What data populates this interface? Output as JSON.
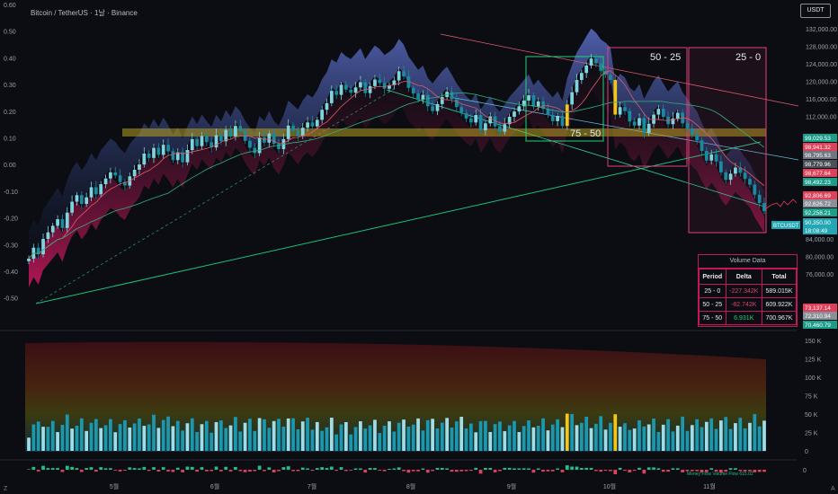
{
  "header": {
    "title": "Bitcoin / TetherUS · 1날 · Binance"
  },
  "currency_button": "USDT",
  "chart_data": {
    "type": "candlestick",
    "x_tick_labels": [
      "5월",
      "6월",
      "7월",
      "8월",
      "9월",
      "10월",
      "11월"
    ],
    "left_axis_labels": [
      "0.60",
      "0.50",
      "0.40",
      "0.30",
      "0.20",
      "0.10",
      "0.00",
      "-0.10",
      "-0.20",
      "-0.30",
      "-0.40",
      "-0.50"
    ],
    "price_axis_labels": [
      "132,000.00",
      "128,000.00",
      "124,000.00",
      "120,000.00",
      "116,000.00",
      "112,000.00",
      "84,000.00",
      "80,000.00",
      "76,000.00"
    ],
    "price_ylim": [
      66000,
      133000
    ],
    "price_badges": [
      {
        "label": "99,029.53",
        "color": "#1a9e8a"
      },
      {
        "label": "98,941.32",
        "color": "#e0405a"
      },
      {
        "label": "98,795.63",
        "color": "#6f7680"
      },
      {
        "label": "98,779.96",
        "color": "#4a4f58"
      },
      {
        "label": "98,677.64",
        "color": "#e0405a"
      },
      {
        "label": "98,492.23",
        "color": "#1a9e8a"
      },
      {
        "label": "92,806.69",
        "color": "#e0405a"
      },
      {
        "label": "92,626.72",
        "color": "#8a8f98"
      },
      {
        "label": "92,258.21",
        "color": "#1a9e8a"
      },
      {
        "label": "90,350.00",
        "color": "#23a7b4"
      },
      {
        "label": "18:08:49",
        "color": "#23a7b4"
      },
      {
        "label": "73,137.14",
        "color": "#e0405a"
      },
      {
        "label": "72,310.94",
        "color": "#8a8f98"
      },
      {
        "label": "70,460.79",
        "color": "#1a9e8a"
      }
    ],
    "symbol_tag": "BTCUSDT",
    "zone_labels": [
      "75 - 50",
      "50 - 25",
      "25 - 0"
    ],
    "volume_axis_labels": [
      "150 K",
      "125 K",
      "100 K",
      "75 K",
      "50 K",
      "25 K",
      "0"
    ],
    "volume_ylim": [
      0,
      150000
    ],
    "oscillator_axis_label": "0",
    "oscillator_legend": "Money Flow Volume Flow 615.02",
    "closes": [
      79500,
      82000,
      80500,
      84000,
      85500,
      87000,
      88500,
      86500,
      90000,
      92500,
      94000,
      92000,
      93500,
      95800,
      94200,
      96500,
      97800,
      99200,
      98500,
      97000,
      96200,
      98300,
      99800,
      101000,
      103500,
      102500,
      104800,
      103200,
      105500,
      104000,
      102000,
      103800,
      101500,
      104300,
      106800,
      105200,
      107500,
      106100,
      104900,
      107700,
      106300,
      108900,
      107400,
      109800,
      108600,
      106400,
      104800,
      103600,
      107200,
      106000,
      108100,
      105700,
      104500,
      106800,
      109900,
      108700,
      107500,
      109400,
      110600,
      109700,
      111200,
      113500,
      115000,
      117800,
      116900,
      119200,
      118100,
      117400,
      118600,
      119800,
      117300,
      118900,
      120400,
      119600,
      118300,
      119100,
      120200,
      122300,
      121100,
      118500,
      117200,
      115800,
      116900,
      114300,
      113200,
      114800,
      116400,
      117600,
      115900,
      114100,
      112700,
      111500,
      110600,
      112300,
      108800,
      110400,
      112000,
      109700,
      108500,
      110200,
      111900,
      113100,
      114300,
      115600,
      116800,
      114200,
      115400,
      113700,
      112300,
      110900,
      112100,
      109800,
      114700,
      117500,
      120300,
      121900,
      123600,
      125200,
      124100,
      122400,
      121500,
      120300,
      112400,
      114100,
      113200,
      110800,
      109900,
      111600,
      108200,
      110300,
      112400,
      113700,
      111900,
      110200,
      111500,
      112800,
      110400,
      109100,
      107800,
      106500,
      104100,
      101900,
      103300,
      101700,
      99200,
      97500,
      98900,
      100300,
      99100,
      97700,
      96400,
      94100,
      92200,
      90350
    ]
  },
  "volume_table": {
    "title": "Volume Data",
    "headers": [
      "Period",
      "Delta",
      "Total"
    ],
    "rows": [
      {
        "period": "25 - 0",
        "delta": "-227.342K",
        "total": "589.015K",
        "sign": "neg"
      },
      {
        "period": "50 - 25",
        "delta": "-82.742K",
        "total": "609.922K",
        "sign": "neg"
      },
      {
        "period": "75 - 50",
        "delta": "6.931K",
        "total": "700.967K",
        "sign": "pos"
      }
    ]
  }
}
